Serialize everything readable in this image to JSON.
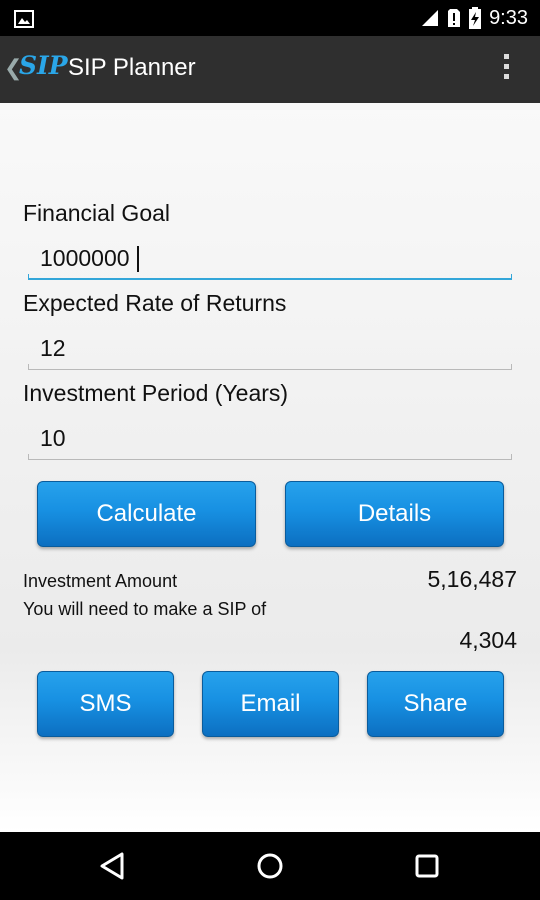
{
  "status_bar": {
    "time": "9:33"
  },
  "action_bar": {
    "logo_text": "SIP",
    "title": "SIP Planner"
  },
  "form": {
    "goal_label": "Financial Goal",
    "goal_value": "1000000",
    "rate_label": "Expected Rate of Returns",
    "rate_value": "12",
    "period_label": "Investment Period (Years)",
    "period_value": "10"
  },
  "buttons": {
    "calculate": "Calculate",
    "details": "Details",
    "sms": "SMS",
    "email": "Email",
    "share": "Share"
  },
  "results": {
    "investment_label": "Investment Amount",
    "investment_value": "5,16,487",
    "sip_label": "You will need to make a SIP of",
    "sip_value": "4,304"
  },
  "colors": {
    "accent": "#33a6d9",
    "button": "#1790e2",
    "action_bar": "#2f2f2f"
  }
}
